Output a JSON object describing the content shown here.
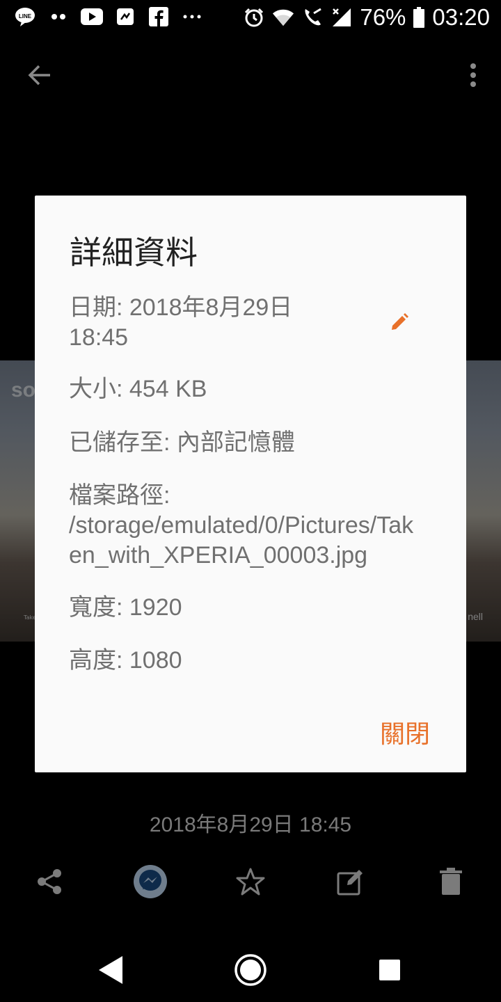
{
  "status_bar": {
    "battery_percent": "76%",
    "time": "03:20",
    "icons": [
      "line-icon",
      "dots-icon",
      "youtube-icon",
      "messenger-status-icon",
      "facebook-icon",
      "more-notifications-icon",
      "alarm-icon",
      "wifi-icon",
      "wifi-calling-icon",
      "signal-icon",
      "battery-icon"
    ]
  },
  "photo": {
    "overlay_word": "so",
    "credit_text": "nell",
    "left_small_text": "Take"
  },
  "dialog": {
    "title": "詳細資料",
    "date_line1": "日期: 2018年8月29日",
    "date_line2": "18:45",
    "size": "大小: 454 KB",
    "saved_to": "已儲存至: 內部記憶體",
    "file_path": "檔案路徑: /storage/emulated/0/Pictures/Taken_with_XPERIA_00003.jpg",
    "width": "寬度: 1920",
    "height": "高度: 1080",
    "close_label": "關閉",
    "accent_color": "#e8712a"
  },
  "photo_date": "2018年8月29日 18:45",
  "actions": [
    "share-icon",
    "messenger-icon",
    "star-icon",
    "edit-icon",
    "delete-icon"
  ],
  "nav": [
    "back-nav-icon",
    "home-nav-icon",
    "recents-nav-icon"
  ]
}
